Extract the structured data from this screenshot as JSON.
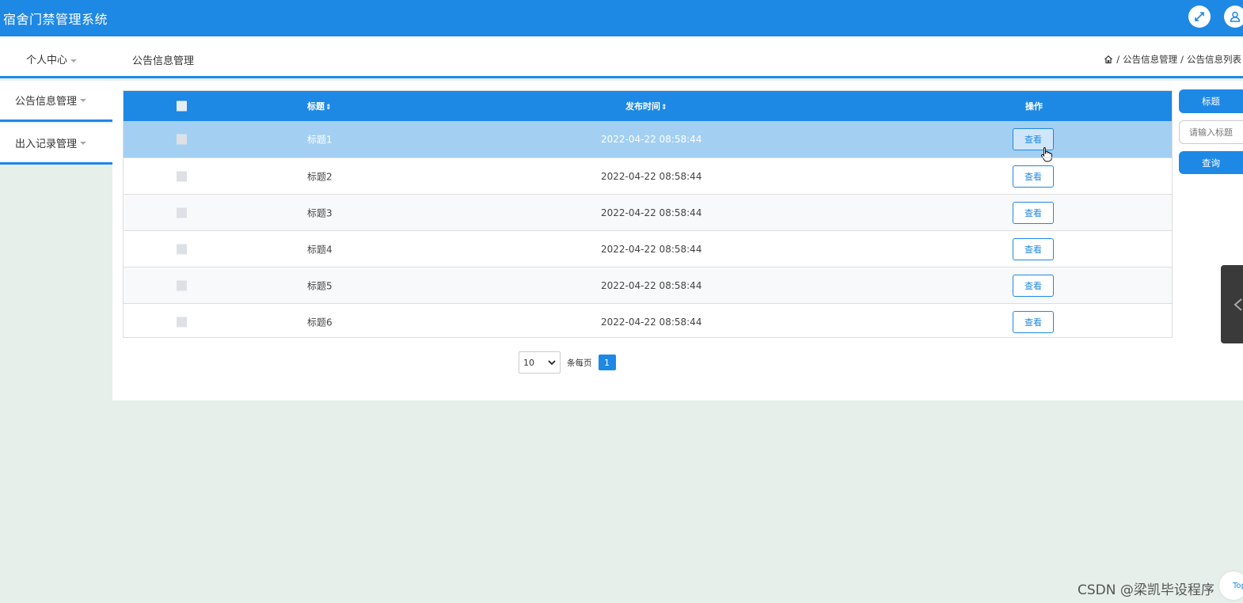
{
  "app": {
    "title": "宿舍门禁管理系统"
  },
  "header": {
    "fullscreen_icon": "fullscreen-icon",
    "user_icon": "user-icon"
  },
  "navbar": {
    "personal_center": "个人中心",
    "current_title": "公告信息管理",
    "breadcrumb": {
      "home_icon": "home-icon",
      "level1": "公告信息管理",
      "level2": "公告信息列表",
      "separator": "/"
    }
  },
  "sidebar": {
    "items": [
      {
        "label": "公告信息管理"
      },
      {
        "label": "出入记录管理"
      }
    ]
  },
  "table": {
    "headers": {
      "title": "标题",
      "time": "发布时间",
      "op": "操作",
      "sort": "⇕"
    },
    "rows": [
      {
        "title": "标题1",
        "time": "2022-04-22 08:58:44",
        "action": "查看"
      },
      {
        "title": "标题2",
        "time": "2022-04-22 08:58:44",
        "action": "查看"
      },
      {
        "title": "标题3",
        "time": "2022-04-22 08:58:44",
        "action": "查看"
      },
      {
        "title": "标题4",
        "time": "2022-04-22 08:58:44",
        "action": "查看"
      },
      {
        "title": "标题5",
        "time": "2022-04-22 08:58:44",
        "action": "查看"
      },
      {
        "title": "标题6",
        "time": "2022-04-22 08:58:44",
        "action": "查看"
      }
    ],
    "highlighted_row": 1
  },
  "pagination": {
    "per_page_value": "10",
    "per_page_label": "条每页",
    "current_page": "1"
  },
  "search": {
    "field_label": "标题",
    "placeholder": "请输入标题",
    "button_label": "查询"
  },
  "floating": {
    "top_label": "Top"
  },
  "watermark": "CSDN @梁凯毕设程序",
  "colors": {
    "primary": "#1e88e5",
    "highlight_row": "#a3cff3",
    "page_bg": "#e6efea"
  }
}
